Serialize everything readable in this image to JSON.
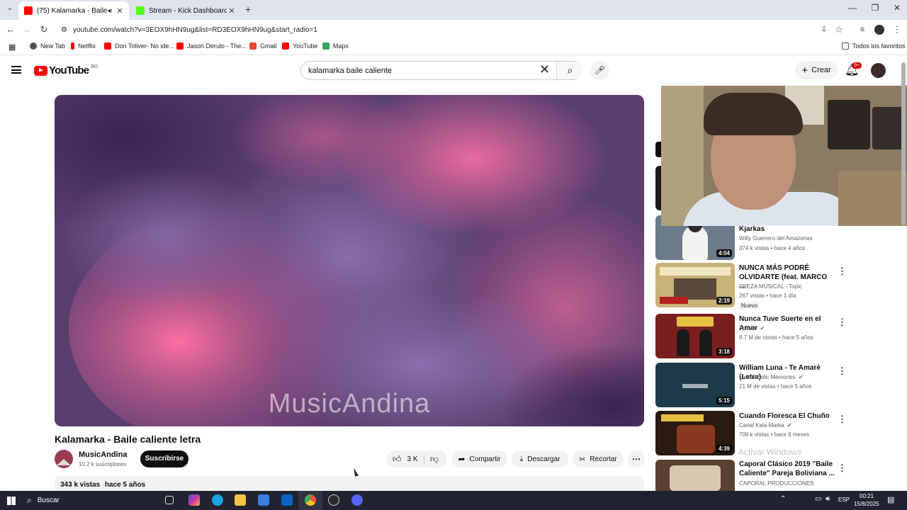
{
  "browser": {
    "tabs": [
      {
        "title": "(75) Kalamarka - Baile calie",
        "active": true,
        "favicon_color": "#ff0000"
      },
      {
        "title": "Stream - Kick Dashboard",
        "active": false,
        "favicon_color": "#53fc18"
      }
    ],
    "url": "youtube.com/watch?v=3EOX9hHN9ug&list=RD3EOX9hHN9ug&start_radio=1",
    "bookmarks": [
      {
        "label": "New Tab"
      },
      {
        "label": "Netflix"
      },
      {
        "label": "Don Toliver- No ide..."
      },
      {
        "label": "Jason Derulo - The..."
      },
      {
        "label": "Gmail"
      },
      {
        "label": "YouTube"
      },
      {
        "label": "Maps"
      }
    ],
    "all_bookmarks_label": "Todos los favoritos"
  },
  "youtube": {
    "logo_text": "YouTube",
    "country": "BO",
    "search_value": "kalamarka baile caliente",
    "create_label": "Crear",
    "notif_count": "9+"
  },
  "video": {
    "watermark": "MusicAndina",
    "title": "Kalamarka - Baile caliente letra",
    "channel": "MusicAndina",
    "subscribers": "10.2 k suscriptores",
    "subscribe_label": "Suscribirse",
    "likes": "3 K",
    "share_label": "Compartir",
    "download_label": "Descargar",
    "clip_label": "Recortar",
    "views": "343 k vistas",
    "age": "hace 5 años"
  },
  "sidebar": [
    {
      "title": "Kjarkas",
      "channel": "Willy Guerrero del Amazonas",
      "meta": "374 k vistas • hace 4 años",
      "duration": "4:04",
      "badge": "",
      "thumb_color": "#6b7b8c"
    },
    {
      "title": "NUNCA MÁS PODRÉ OLVIDARTE (feat. MARCO ...",
      "channel": "FREZA MUSICAL - Topic",
      "meta": "267 vistas • hace 1 día",
      "duration": "2:19",
      "badge": "Nuevo",
      "thumb_color": "#c8b27a"
    },
    {
      "title": "Nunca Tuve Suerte en el Amor",
      "channel": "TUPAY",
      "meta": "8.7 M de vistas • hace 5 años",
      "duration": "3:18",
      "badge": "",
      "thumb_color": "#7a1f1f"
    },
    {
      "title": "William Luna - Te Amaré (Letra)",
      "channel": "Melancholic Memories",
      "meta": "21 M de vistas • hace 5 años",
      "duration": "5:15",
      "badge": "",
      "thumb_color": "#1d3a4a"
    },
    {
      "title": "Cuando Floresca El Chuño",
      "channel": "Canal Kala Marka",
      "meta": "706 k vistas • hace 9 meses",
      "duration": "4:39",
      "badge": "",
      "thumb_color": "#2a1a10"
    },
    {
      "title": "Caporal Clásico 2019 \"Baile Caliente\" Pareja Boliviana ...",
      "channel": "CAPORAL PRODUCCIONES",
      "meta": "",
      "duration": "",
      "badge": "",
      "thumb_color": "#5a4030"
    }
  ],
  "watermark_text": "Activar Windows",
  "taskbar": {
    "search_placeholder": "Buscar",
    "lang": "ESP",
    "time": "00:21",
    "date": "15/8/2025"
  }
}
